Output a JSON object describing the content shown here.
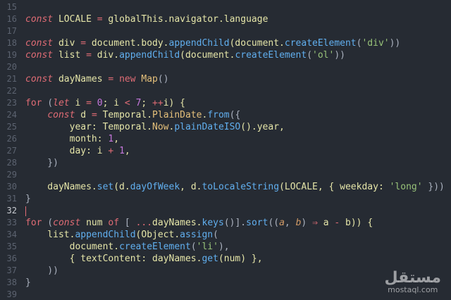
{
  "editor": {
    "current_line": 32,
    "lines": [
      {
        "n": "15",
        "tokens": []
      },
      {
        "n": "16",
        "tokens": [
          {
            "t": "const",
            "c": "kw"
          },
          {
            "t": " LOCALE ",
            "c": "var"
          },
          {
            "t": "=",
            "c": "op"
          },
          {
            "t": " globalThis.navigator.language",
            "c": "plain"
          }
        ]
      },
      {
        "n": "17",
        "tokens": []
      },
      {
        "n": "18",
        "tokens": [
          {
            "t": "const",
            "c": "kw"
          },
          {
            "t": " div ",
            "c": "var"
          },
          {
            "t": "=",
            "c": "op"
          },
          {
            "t": " document.body.",
            "c": "plain"
          },
          {
            "t": "appendChild",
            "c": "fn"
          },
          {
            "t": "(document.",
            "c": "plain"
          },
          {
            "t": "createElement",
            "c": "fn"
          },
          {
            "t": "(",
            "c": "punct"
          },
          {
            "t": "'div'",
            "c": "str"
          },
          {
            "t": "))",
            "c": "punct"
          }
        ]
      },
      {
        "n": "19",
        "tokens": [
          {
            "t": "const",
            "c": "kw"
          },
          {
            "t": " list ",
            "c": "var"
          },
          {
            "t": "=",
            "c": "op"
          },
          {
            "t": " div.",
            "c": "plain"
          },
          {
            "t": "appendChild",
            "c": "fn"
          },
          {
            "t": "(document.",
            "c": "plain"
          },
          {
            "t": "createElement",
            "c": "fn"
          },
          {
            "t": "(",
            "c": "punct"
          },
          {
            "t": "'ol'",
            "c": "str"
          },
          {
            "t": "))",
            "c": "punct"
          }
        ]
      },
      {
        "n": "20",
        "tokens": []
      },
      {
        "n": "21",
        "tokens": [
          {
            "t": "const",
            "c": "kw"
          },
          {
            "t": " dayNames ",
            "c": "var"
          },
          {
            "t": "=",
            "c": "op"
          },
          {
            "t": " new ",
            "c": "kw2"
          },
          {
            "t": "Map",
            "c": "obj"
          },
          {
            "t": "()",
            "c": "punct"
          }
        ]
      },
      {
        "n": "22",
        "tokens": []
      },
      {
        "n": "23",
        "tokens": [
          {
            "t": "for",
            "c": "kw2"
          },
          {
            "t": " (",
            "c": "punct"
          },
          {
            "t": "let",
            "c": "kw"
          },
          {
            "t": " i ",
            "c": "plain"
          },
          {
            "t": "=",
            "c": "op"
          },
          {
            "t": " ",
            "c": "plain"
          },
          {
            "t": "0",
            "c": "num"
          },
          {
            "t": "; i ",
            "c": "plain"
          },
          {
            "t": "<",
            "c": "op"
          },
          {
            "t": " ",
            "c": "plain"
          },
          {
            "t": "7",
            "c": "num"
          },
          {
            "t": "; ",
            "c": "plain"
          },
          {
            "t": "++",
            "c": "op"
          },
          {
            "t": "i) {",
            "c": "plain"
          }
        ]
      },
      {
        "n": "24",
        "tokens": [
          {
            "t": "    ",
            "c": "plain"
          },
          {
            "t": "const",
            "c": "kw"
          },
          {
            "t": " d ",
            "c": "var"
          },
          {
            "t": "=",
            "c": "op"
          },
          {
            "t": " Temporal.",
            "c": "plain"
          },
          {
            "t": "PlainDate",
            "c": "obj"
          },
          {
            "t": ".",
            "c": "plain"
          },
          {
            "t": "from",
            "c": "fn"
          },
          {
            "t": "({",
            "c": "punct"
          }
        ]
      },
      {
        "n": "25",
        "tokens": [
          {
            "t": "        year: Temporal.",
            "c": "plain"
          },
          {
            "t": "Now",
            "c": "obj"
          },
          {
            "t": ".",
            "c": "plain"
          },
          {
            "t": "plainDateISO",
            "c": "fn"
          },
          {
            "t": "().year,",
            "c": "plain"
          }
        ]
      },
      {
        "n": "26",
        "tokens": [
          {
            "t": "        month: ",
            "c": "plain"
          },
          {
            "t": "1",
            "c": "num"
          },
          {
            "t": ",",
            "c": "plain"
          }
        ]
      },
      {
        "n": "27",
        "tokens": [
          {
            "t": "        day: i ",
            "c": "plain"
          },
          {
            "t": "+",
            "c": "op"
          },
          {
            "t": " ",
            "c": "plain"
          },
          {
            "t": "1",
            "c": "num"
          },
          {
            "t": ",",
            "c": "plain"
          }
        ]
      },
      {
        "n": "28",
        "tokens": [
          {
            "t": "    })",
            "c": "punct"
          }
        ]
      },
      {
        "n": "29",
        "tokens": []
      },
      {
        "n": "30",
        "tokens": [
          {
            "t": "    dayNames.",
            "c": "plain"
          },
          {
            "t": "set",
            "c": "fn"
          },
          {
            "t": "(d.",
            "c": "plain"
          },
          {
            "t": "dayOfWeek",
            "c": "fn"
          },
          {
            "t": ", d.",
            "c": "plain"
          },
          {
            "t": "toLocaleString",
            "c": "fn"
          },
          {
            "t": "(LOCALE, { weekday: ",
            "c": "plain"
          },
          {
            "t": "'long'",
            "c": "str"
          },
          {
            "t": " }))",
            "c": "punct"
          }
        ]
      },
      {
        "n": "31",
        "tokens": [
          {
            "t": "}",
            "c": "punct"
          }
        ]
      },
      {
        "n": "32",
        "tokens": []
      },
      {
        "n": "33",
        "tokens": [
          {
            "t": "for",
            "c": "kw2"
          },
          {
            "t": " (",
            "c": "punct"
          },
          {
            "t": "const",
            "c": "kw"
          },
          {
            "t": " num ",
            "c": "plain"
          },
          {
            "t": "of",
            "c": "kw2"
          },
          {
            "t": " [ ",
            "c": "punct"
          },
          {
            "t": "...",
            "c": "op"
          },
          {
            "t": "dayNames.",
            "c": "plain"
          },
          {
            "t": "keys",
            "c": "fn"
          },
          {
            "t": "()].",
            "c": "punct"
          },
          {
            "t": "sort",
            "c": "fn"
          },
          {
            "t": "((",
            "c": "punct"
          },
          {
            "t": "a",
            "c": "param"
          },
          {
            "t": ", ",
            "c": "punct"
          },
          {
            "t": "b",
            "c": "param"
          },
          {
            "t": ") ",
            "c": "punct"
          },
          {
            "t": "⇒",
            "c": "op"
          },
          {
            "t": " a ",
            "c": "plain"
          },
          {
            "t": "-",
            "c": "op"
          },
          {
            "t": " b)) {",
            "c": "plain"
          }
        ]
      },
      {
        "n": "34",
        "tokens": [
          {
            "t": "    list.",
            "c": "plain"
          },
          {
            "t": "appendChild",
            "c": "fn"
          },
          {
            "t": "(Object.",
            "c": "plain"
          },
          {
            "t": "assign",
            "c": "fn"
          },
          {
            "t": "(",
            "c": "punct"
          }
        ]
      },
      {
        "n": "35",
        "tokens": [
          {
            "t": "        document.",
            "c": "plain"
          },
          {
            "t": "createElement",
            "c": "fn"
          },
          {
            "t": "(",
            "c": "punct"
          },
          {
            "t": "'li'",
            "c": "str"
          },
          {
            "t": "),",
            "c": "punct"
          }
        ]
      },
      {
        "n": "36",
        "tokens": [
          {
            "t": "        { textContent: dayNames.",
            "c": "plain"
          },
          {
            "t": "get",
            "c": "fn"
          },
          {
            "t": "(num) },",
            "c": "plain"
          }
        ]
      },
      {
        "n": "37",
        "tokens": [
          {
            "t": "    ))",
            "c": "punct"
          }
        ]
      },
      {
        "n": "38",
        "tokens": [
          {
            "t": "}",
            "c": "punct"
          }
        ]
      },
      {
        "n": "39",
        "tokens": []
      }
    ]
  },
  "watermark": {
    "logo": "مستقل",
    "site": "mostaql.com"
  }
}
